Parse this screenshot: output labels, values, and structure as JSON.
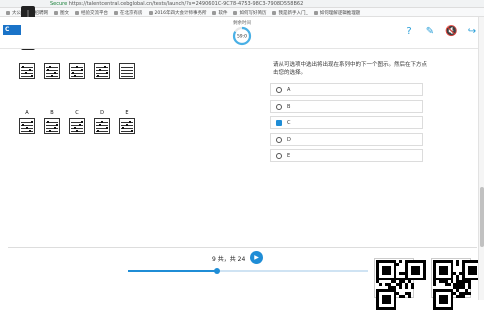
{
  "browser": {
    "address_prefix": "Secure",
    "url": "https://talentcentral.cebglobal.cn/tests/launch/?s=2490601C-9C78-4753-98C3-7908D558B62"
  },
  "bookmarks": [
    "大公司员工招聘网",
    "图文",
    "经验交流平台",
    "在北京有房",
    "2016年四大会计师事务所",
    "软件",
    "如何写好简历",
    "我是新手入门_",
    "如何理解逻辑推理题"
  ],
  "volume": {
    "label": "54",
    "level": 0.7
  },
  "header": {
    "logo_text": "C",
    "timer_label": "剩余时间",
    "timer_value": "59:0",
    "icons": [
      "help-icon",
      "notes-icon",
      "mute-icon",
      "exit-icon"
    ]
  },
  "question": {
    "text": "请从可选项中选出将出现在系列中的下一个图示。然后在下方点击您的选择。"
  },
  "answer_letters": [
    "A",
    "B",
    "C",
    "D",
    "E"
  ],
  "options": [
    {
      "label": "A",
      "selected": false
    },
    {
      "label": "B",
      "selected": false
    },
    {
      "label": "C",
      "selected": true
    },
    {
      "label": "D",
      "selected": false
    },
    {
      "label": "E",
      "selected": false
    }
  ],
  "footer": {
    "page_text": "9 共，共 24",
    "next_icon": "play-icon",
    "progress": 0.37
  },
  "colors": {
    "accent": "#1f8dd6",
    "logo": "#1a73c8",
    "icon": "#2a9fd8"
  }
}
